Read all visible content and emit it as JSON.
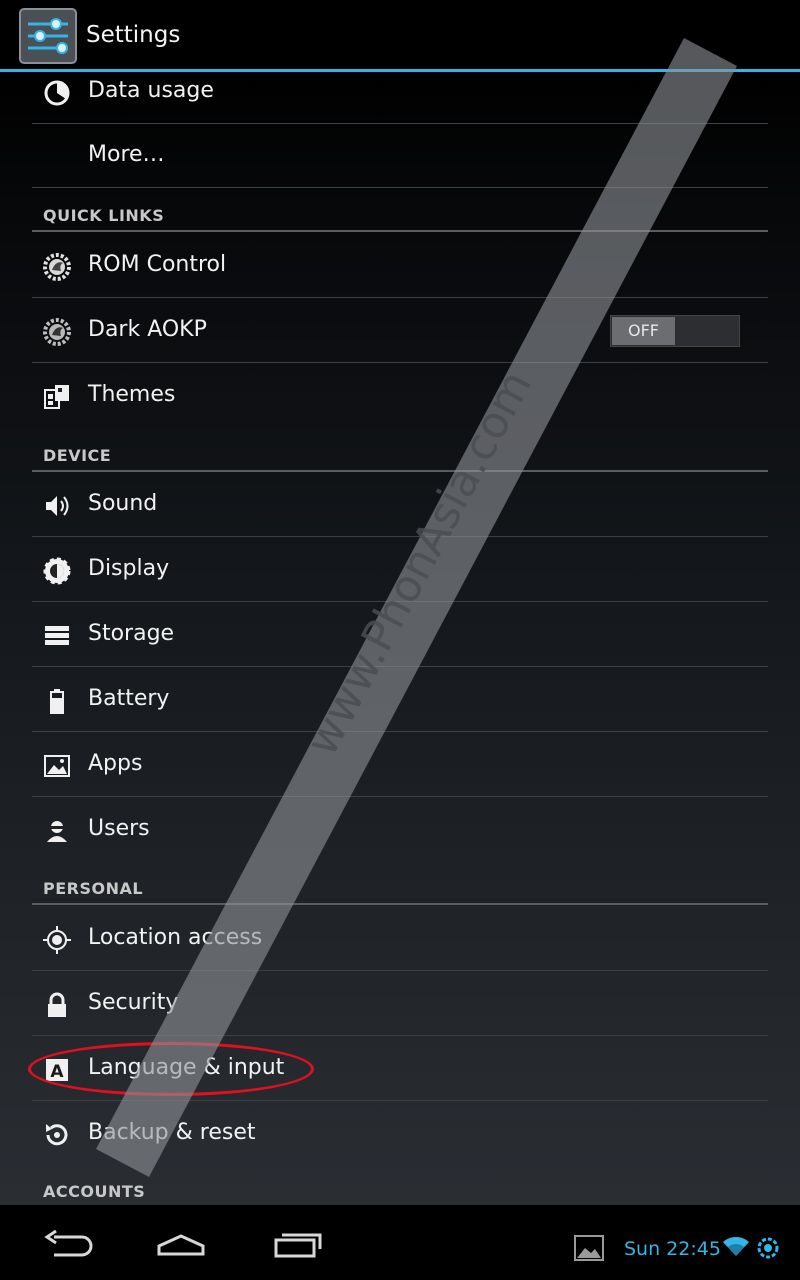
{
  "app": {
    "title": "Settings"
  },
  "items": {
    "data_usage": "Data usage",
    "more": "More…",
    "rom_control": "ROM Control",
    "dark_aokp": "Dark AOKP",
    "themes": "Themes",
    "sound": "Sound",
    "display": "Display",
    "storage": "Storage",
    "battery": "Battery",
    "apps": "Apps",
    "users": "Users",
    "location_access": "Location access",
    "security": "Security",
    "language_input": "Language & input",
    "backup_reset": "Backup & reset"
  },
  "sections": {
    "quick_links": "QUICK LINKS",
    "device": "DEVICE",
    "personal": "PERSONAL",
    "accounts": "ACCOUNTS"
  },
  "toggles": {
    "dark_aokp": "OFF"
  },
  "statusbar": {
    "time": "Sun 22:45"
  },
  "watermark": "www.PhonAsia.com",
  "colors": {
    "accent": "#33b5e5",
    "highlight": "#e0101e"
  }
}
